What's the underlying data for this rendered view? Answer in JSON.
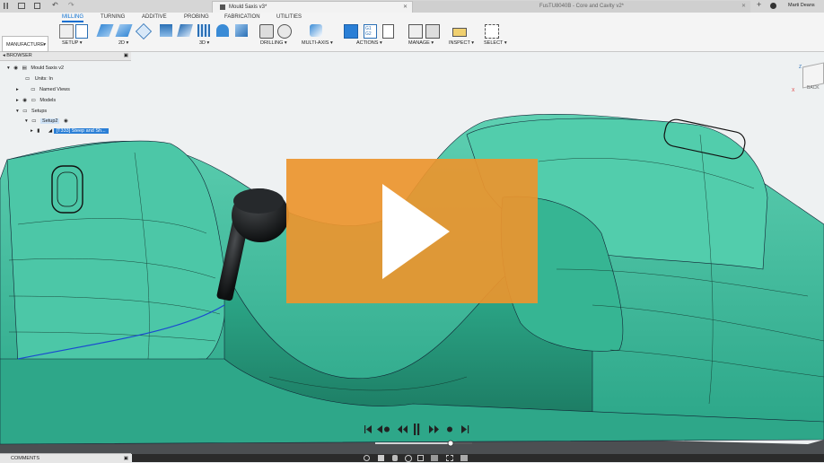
{
  "window": {
    "doc_tab_active": "Mould 5axis v3*",
    "doc_tab_inactive": "FusTU8040B - Core and Cavity v2*",
    "user": "Marti Deans"
  },
  "workspace": {
    "label": "MANUFACTURE"
  },
  "ribbon": {
    "tabs": [
      "MILLING",
      "TURNING",
      "ADDITIVE",
      "PROBING",
      "FABRICATION",
      "UTILITIES"
    ],
    "groups": [
      "SETUP",
      "2D",
      "3D",
      "DRILLING",
      "MULTI-AXIS",
      "ACTIONS",
      "MANAGE",
      "INSPECT",
      "SELECT"
    ],
    "g1g2": {
      "l1": "G1",
      "l2": "G2"
    }
  },
  "browser": {
    "title": "BROWSER",
    "items": [
      "Mould 5axis v2",
      "Units: In",
      "Named Views",
      "Models",
      "Setups",
      "Setup2",
      "[T333] Steep and Sh..."
    ]
  },
  "comments": {
    "label": "COMMENTS"
  },
  "viewcube": {
    "face": "BACK",
    "axis_x": "X",
    "axis_z": "Z"
  },
  "colors": {
    "model": "#3dbd9c",
    "overlay": "#ec952e",
    "accent": "#0a6ed1"
  }
}
